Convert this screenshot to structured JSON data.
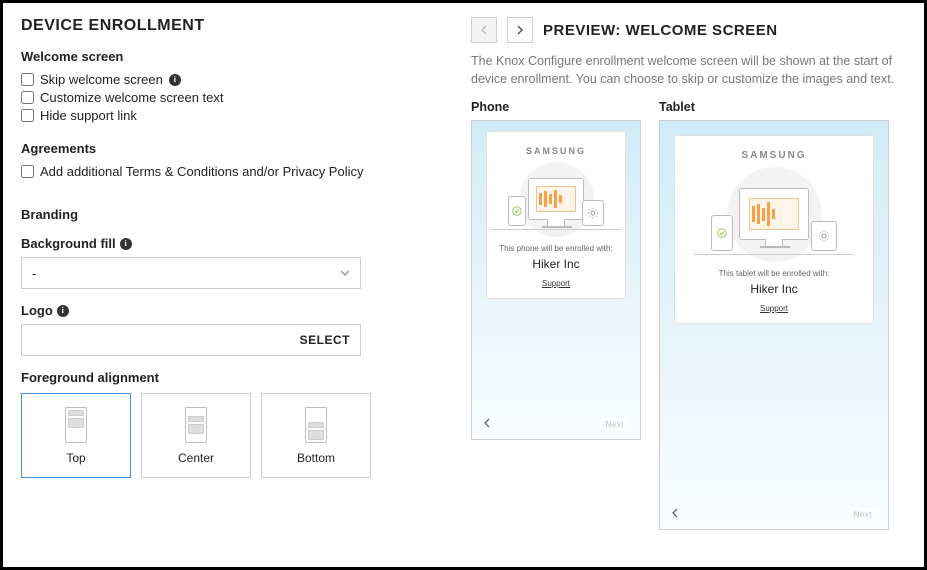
{
  "header": {
    "title": "DEVICE ENROLLMENT"
  },
  "welcome": {
    "title": "Welcome screen",
    "skip_label": "Skip welcome screen",
    "customize_label": "Customize welcome screen text",
    "hide_support_label": "Hide support link"
  },
  "agreements": {
    "title": "Agreements",
    "add_terms_label": "Add additional Terms & Conditions and/or Privacy Policy"
  },
  "branding": {
    "title": "Branding",
    "bg_fill_label": "Background fill",
    "bg_fill_value": "-",
    "logo_label": "Logo",
    "logo_button": "SELECT",
    "fg_align_label": "Foreground alignment",
    "align_options": {
      "top": "Top",
      "center": "Center",
      "bottom": "Bottom"
    }
  },
  "preview": {
    "title": "PREVIEW: WELCOME SCREEN",
    "description": "The Knox Configure enrollment welcome screen will be shown at the start of device enrollment. You can choose to skip or customize the images and text.",
    "phone_label": "Phone",
    "tablet_label": "Tablet",
    "samsung": "SAMSUNG",
    "phone_enroll_text": "This phone will be enrolled with:",
    "tablet_enroll_text": "This tablet will be enrolled with:",
    "company": "Hiker Inc",
    "support": "Support",
    "next": "Next"
  }
}
